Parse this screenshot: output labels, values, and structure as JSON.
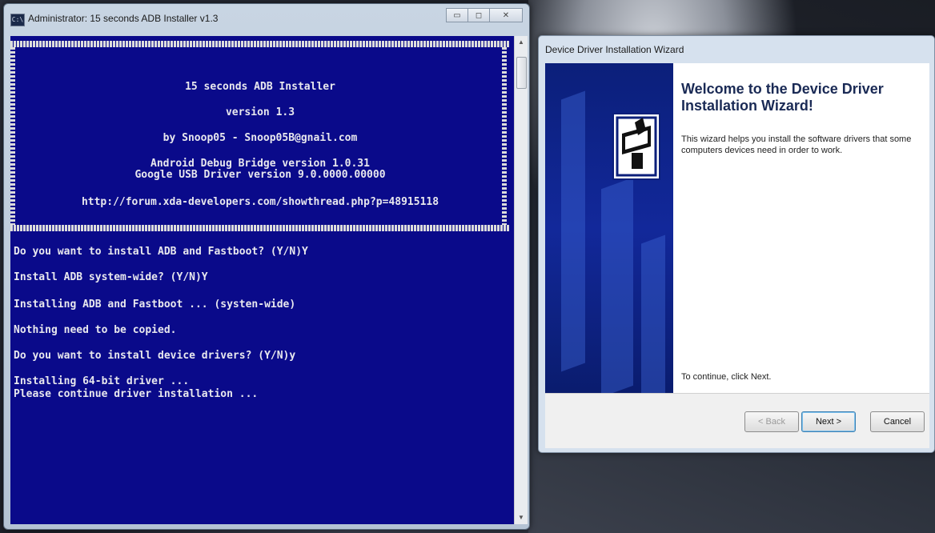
{
  "console": {
    "title": "Administrator: 15 seconds ADB Installer v1.3",
    "title_icon_text": "C:\\",
    "buttons": {
      "minimize": "▭",
      "maximize": "◻",
      "close": "✕"
    },
    "banner": {
      "app_name": "15 seconds ADB Installer",
      "version": "version 1.3",
      "author": "by Snoop05 - Snoop05B@gnail.com",
      "adb_version": "Android Debug Bridge version 1.0.31",
      "usb_driver": "Google USB Driver version 9.0.0000.00000",
      "url": "http://forum.xda-developers.com/showthread.php?p=48915118"
    },
    "lines": [
      "Do you want to install ADB and Fastboot? (Y/N)Y",
      "Install ADB system-wide? (Y/N)Y",
      "Installing ADB and Fastboot ... (systen-wide)",
      "Nothing need to be copied.",
      "Do you want to install device drivers? (Y/N)y",
      "Installing 64-bit driver ...",
      "Please continue driver installation ..."
    ],
    "scroll_up": "▲",
    "scroll_down": "▼"
  },
  "wizard": {
    "title": "Device Driver Installation Wizard",
    "heading": "Welcome to the Device Driver Installation Wizard!",
    "description": "This wizard helps you install the software drivers that some computers devices need in order to work.",
    "continue_text": "To continue, click Next.",
    "buttons": {
      "back": "< Back",
      "next": "Next >",
      "cancel": "Cancel"
    }
  }
}
